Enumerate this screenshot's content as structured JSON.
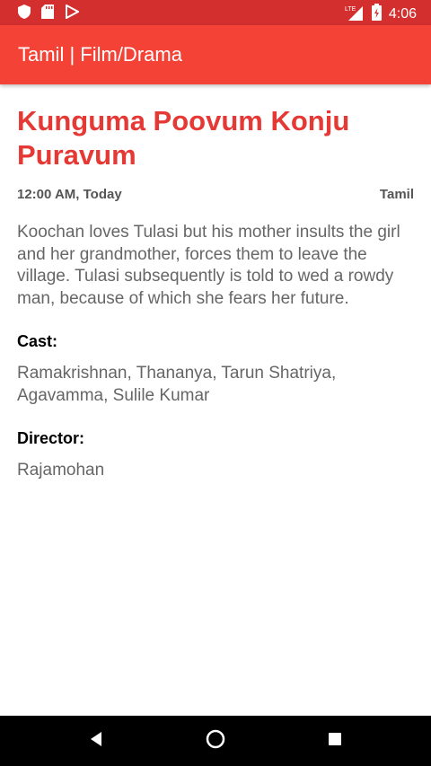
{
  "status_bar": {
    "time": "4:06",
    "network": "LTE",
    "icons": [
      "shield-icon",
      "sd-card-icon",
      "play-store-icon",
      "signal-icon",
      "battery-charging-icon"
    ]
  },
  "app_bar": {
    "title": "Tamil | Film/Drama"
  },
  "program": {
    "title": "Kunguma Poovum Konju Puravum",
    "time": "12:00 AM, Today",
    "channel": "Tamil",
    "description": "Koochan loves Tulasi but his mother insults the girl and her grandmother, forces them to leave the village. Tulasi subsequently is told to wed a rowdy man, because of which she fears her future.",
    "cast_label": "Cast:",
    "cast_value": "Ramakrishnan, Thananya, Tarun Shatriya, Agavamma, Sulile Kumar",
    "director_label": "Director:",
    "director_value": "Rajamohan"
  },
  "nav_bar": {
    "icons": [
      "back-icon",
      "home-icon",
      "recents-icon"
    ]
  },
  "colors": {
    "status_bar": "#d32f2f",
    "app_bar": "#f44336",
    "title": "#e53935"
  }
}
